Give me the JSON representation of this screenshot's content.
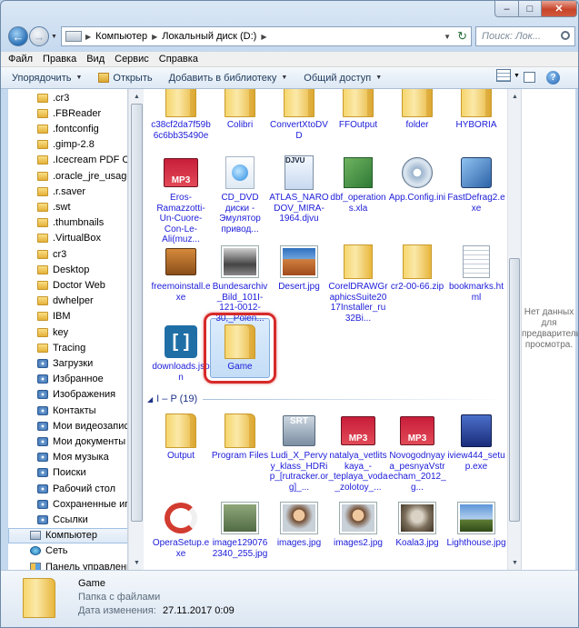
{
  "window": {
    "minimize": "–",
    "maximize": "□",
    "close": "✕"
  },
  "address": {
    "segments": [
      "Компьютер",
      "Локальный диск (D:)"
    ]
  },
  "search": {
    "placeholder": "Поиск: Лок..."
  },
  "menu": [
    "Файл",
    "Правка",
    "Вид",
    "Сервис",
    "Справка"
  ],
  "toolbar": {
    "organize": "Упорядочить",
    "open": "Открыть",
    "add_library": "Добавить в библиотеку",
    "share": "Общий доступ",
    "help": "?"
  },
  "nav": [
    {
      "label": ".cr3",
      "icon": "folder"
    },
    {
      "label": ".FBReader",
      "icon": "folder"
    },
    {
      "label": ".fontconfig",
      "icon": "folder"
    },
    {
      "label": ".gimp-2.8",
      "icon": "folder"
    },
    {
      "label": ".Icecream PDF Con",
      "icon": "folder"
    },
    {
      "label": ".oracle_jre_usage",
      "icon": "folder"
    },
    {
      "label": ".r.saver",
      "icon": "folder"
    },
    {
      "label": ".swt",
      "icon": "folder"
    },
    {
      "label": ".thumbnails",
      "icon": "folder"
    },
    {
      "label": ".VirtualBox",
      "icon": "folder"
    },
    {
      "label": "cr3",
      "icon": "folder"
    },
    {
      "label": "Desktop",
      "icon": "folder"
    },
    {
      "label": "Doctor Web",
      "icon": "folder"
    },
    {
      "label": "dwhelper",
      "icon": "folder"
    },
    {
      "label": "IBM",
      "icon": "folder"
    },
    {
      "label": "key",
      "icon": "folder"
    },
    {
      "label": "Tracing",
      "icon": "folder"
    },
    {
      "label": "Загрузки",
      "icon": "special-folder"
    },
    {
      "label": "Избранное",
      "icon": "special-folder"
    },
    {
      "label": "Изображения",
      "icon": "special-folder"
    },
    {
      "label": "Контакты",
      "icon": "special-folder"
    },
    {
      "label": "Мои видеозаписи",
      "icon": "special-folder"
    },
    {
      "label": "Мои документы",
      "icon": "special-folder"
    },
    {
      "label": "Моя музыка",
      "icon": "special-folder"
    },
    {
      "label": "Поиски",
      "icon": "special-folder"
    },
    {
      "label": "Рабочий стол",
      "icon": "special-folder"
    },
    {
      "label": "Сохраненные игры",
      "icon": "special-folder"
    },
    {
      "label": "Ссылки",
      "icon": "special-folder"
    },
    {
      "label": "Компьютер",
      "icon": "computer",
      "selected": true
    },
    {
      "label": "Сеть",
      "icon": "network"
    },
    {
      "label": "Панель управления",
      "icon": "control-panel"
    }
  ],
  "files_row1": [
    "c38cf2da7f59b6c6bb35490e",
    "Colibri",
    "ConvertXtoDVD",
    "FFOutput",
    "folder",
    "HYBORIA"
  ],
  "files": [
    {
      "label": "Eros-Ramazzotti-Un-Cuore-Con-Le-Ali(muz...",
      "icon": "mp3",
      "badge": "MP3"
    },
    {
      "label": "CD_DVD диски - Эмулятор привод...",
      "icon": "web"
    },
    {
      "label": "ATLAS_NARODOV_MIRA-1964.djvu",
      "icon": "djvu",
      "badge": "DJVU"
    },
    {
      "label": "dbf_operations.xla",
      "icon": "xla"
    },
    {
      "label": "App.Config.ini",
      "icon": "config"
    },
    {
      "label": "FastDefrag2.exe",
      "icon": "exe"
    },
    {
      "label": "freemoinstall.exe",
      "icon": "installer"
    },
    {
      "label": "Bundesarchiv_Bild_101I-121-0012-30,_Polen...",
      "icon": "photo-bw"
    },
    {
      "label": "Desert.jpg",
      "icon": "photo-desert"
    },
    {
      "label": "CorelDRAWGraphicsSuite2017Installer_ru32Bi...",
      "icon": "folder-cdr"
    },
    {
      "label": "cr2-00-66.zip",
      "icon": "zip"
    },
    {
      "label": "bookmarks.html",
      "icon": "document"
    },
    {
      "label": "downloads.json",
      "icon": "json",
      "badge": "[ ]"
    },
    {
      "label": "Game",
      "icon": "folder",
      "selected": true
    }
  ],
  "group": {
    "label": "I – P (19)"
  },
  "files_group2": [
    {
      "label": "Output",
      "icon": "folder-doc"
    },
    {
      "label": "Program Files",
      "icon": "folder"
    },
    {
      "label": "Ludi_X_Pervyy_klass_HDRip_[rutracker.org]_...",
      "icon": "srt",
      "badge": "SRT"
    },
    {
      "label": "natalya_vetlitskaya_-_teplaya_voda_zolotoy_...",
      "icon": "mp3",
      "badge": "MP3"
    },
    {
      "label": "Novogodnyaya_pesnyaVstrecham_2012_g...",
      "icon": "mp3",
      "badge": "MP3"
    },
    {
      "label": "iview444_setup.exe",
      "icon": "installer-iview"
    },
    {
      "label": "OperaSetup.exe",
      "icon": "opera"
    },
    {
      "label": "image1290762340_255.jpg",
      "icon": "photo-money"
    },
    {
      "label": "images.jpg",
      "icon": "photo-face"
    },
    {
      "label": "images2.jpg",
      "icon": "photo-face"
    },
    {
      "label": "Koala3.jpg",
      "icon": "photo-koala"
    },
    {
      "label": "Lighthouse.jpg",
      "icon": "photo-lighthouse"
    }
  ],
  "preview": {
    "text": "Нет данных для предварительного просмотра."
  },
  "details": {
    "name": "Game",
    "type": "Папка с файлами",
    "date_label": "Дата изменения:",
    "date": "27.11.2017 0:09"
  }
}
